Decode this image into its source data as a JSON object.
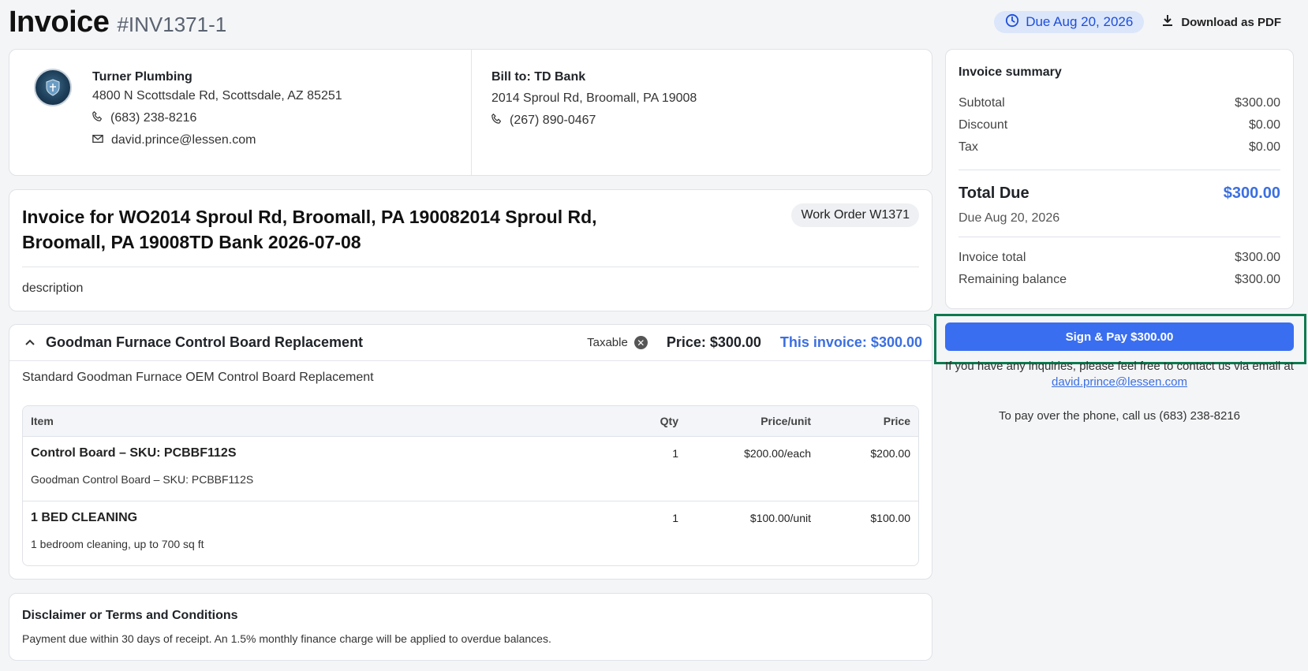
{
  "header": {
    "title": "Invoice",
    "invoice_number": "#INV1371-1",
    "due_label": "Due Aug 20, 2026",
    "download_label": "Download as PDF"
  },
  "company": {
    "name": "Turner Plumbing",
    "address": "4800 N Scottsdale Rd, Scottsdale, AZ 85251",
    "phone": "(683) 238-8216",
    "email": "david.prince@lessen.com"
  },
  "bill_to": {
    "title": "Bill to: TD Bank",
    "address": "2014 Sproul Rd, Broomall, PA 19008",
    "phone": "(267) 890-0467"
  },
  "work_order": {
    "title": "Invoice for WO2014 Sproul Rd, Broomall, PA 190082014 Sproul Rd, Broomall, PA 19008TD Bank 2026-07-08",
    "badge": "Work Order W1371",
    "description": "description"
  },
  "line_item": {
    "name": "Goodman Furnace Control Board Replacement",
    "taxable_label": "Taxable",
    "price_label": "Price: $300.00",
    "this_invoice_label": "This invoice: $300.00",
    "description": "Standard Goodman Furnace OEM Control Board Replacement",
    "table": {
      "headers": {
        "item": "Item",
        "qty": "Qty",
        "ppu": "Price/unit",
        "price": "Price"
      },
      "rows": [
        {
          "name": "Control Board – SKU: PCBBF112S",
          "qty": "1",
          "ppu": "$200.00/each",
          "price": "$200.00",
          "sub": "Goodman Control Board – SKU: PCBBF112S"
        },
        {
          "name": "1 BED CLEANING",
          "qty": "1",
          "ppu": "$100.00/unit",
          "price": "$100.00",
          "sub": "1 bedroom cleaning, up to 700 sq ft"
        }
      ]
    }
  },
  "disclaimer": {
    "title": "Disclaimer or Terms and Conditions",
    "text": "Payment due within 30 days of receipt. An 1.5% monthly finance charge will be applied to overdue balances."
  },
  "summary": {
    "title": "Invoice summary",
    "subtotal_label": "Subtotal",
    "subtotal": "$300.00",
    "discount_label": "Discount",
    "discount": "$0.00",
    "tax_label": "Tax",
    "tax": "$0.00",
    "total_label": "Total Due",
    "total": "$300.00",
    "due_date": "Due Aug 20, 2026",
    "invoice_total_label": "Invoice total",
    "invoice_total": "$300.00",
    "remaining_label": "Remaining balance",
    "remaining": "$300.00"
  },
  "pay": {
    "button_label": "Sign & Pay $300.00",
    "inquiry_text": "If you have any inquiries, please feel free to contact us via email at",
    "inquiry_email": "david.prince@lessen.com",
    "phone_note": "To pay over the phone, call us (683) 238-8216"
  },
  "colors": {
    "accent": "#3a6ef0",
    "highlight_frame": "#0d7a4f",
    "due_pill_bg": "#dbe6fb"
  },
  "icons": [
    "clock-icon",
    "download-icon",
    "company-logo",
    "phone-icon",
    "mail-icon",
    "chevron-up-icon",
    "remove-x-icon"
  ]
}
